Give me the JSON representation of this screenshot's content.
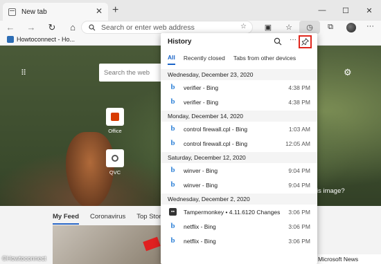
{
  "window": {
    "tab_title": "New tab",
    "minimize_icon": "minimize-icon",
    "maximize_icon": "maximize-icon",
    "close_icon": "close-icon"
  },
  "navbar": {
    "address_placeholder": "Search or enter web address"
  },
  "bookmarks": {
    "items": [
      {
        "label": "Howtoconnect - Ho..."
      }
    ]
  },
  "page": {
    "search_placeholder": "Search the web",
    "tiles": [
      {
        "label": "Office"
      },
      {
        "label": "QVC"
      }
    ],
    "image_prompt": "is image?",
    "feed_tabs": [
      "My Feed",
      "Coronavirus",
      "Top Stor"
    ],
    "news_pill": "Microsoft News",
    "watermark": "©Howtoconnect"
  },
  "history": {
    "title": "History",
    "tabs": [
      "All",
      "Recently closed",
      "Tabs from other devices"
    ],
    "sections": [
      {
        "date": "Wednesday, December 23, 2020",
        "items": [
          {
            "label": "verifier - Bing",
            "time": "4:38 PM",
            "icon": "bing"
          },
          {
            "label": "verifier - Bing",
            "time": "4:38 PM",
            "icon": "bing"
          }
        ]
      },
      {
        "date": "Monday, December 14, 2020",
        "items": [
          {
            "label": "control firewall.cpl - Bing",
            "time": "1:03 AM",
            "icon": "bing"
          },
          {
            "label": "control firewall.cpl - Bing",
            "time": "12:05 AM",
            "icon": "bing"
          }
        ]
      },
      {
        "date": "Saturday, December 12, 2020",
        "items": [
          {
            "label": "winver - Bing",
            "time": "9:04 PM",
            "icon": "bing"
          },
          {
            "label": "winver - Bing",
            "time": "9:04 PM",
            "icon": "bing"
          }
        ]
      },
      {
        "date": "Wednesday, December 2, 2020",
        "items": [
          {
            "label": "Tampermonkey • 4.11.6120 Changes",
            "time": "3:06 PM",
            "icon": "tampermonkey"
          },
          {
            "label": "netflix - Bing",
            "time": "3:06 PM",
            "icon": "bing"
          },
          {
            "label": "netflix - Bing",
            "time": "3:06 PM",
            "icon": "bing"
          }
        ]
      }
    ]
  },
  "colors": {
    "pin_highlight": "#e0261c",
    "accent_blue": "#1a64c8",
    "bing_blue": "#2b7fd6"
  }
}
